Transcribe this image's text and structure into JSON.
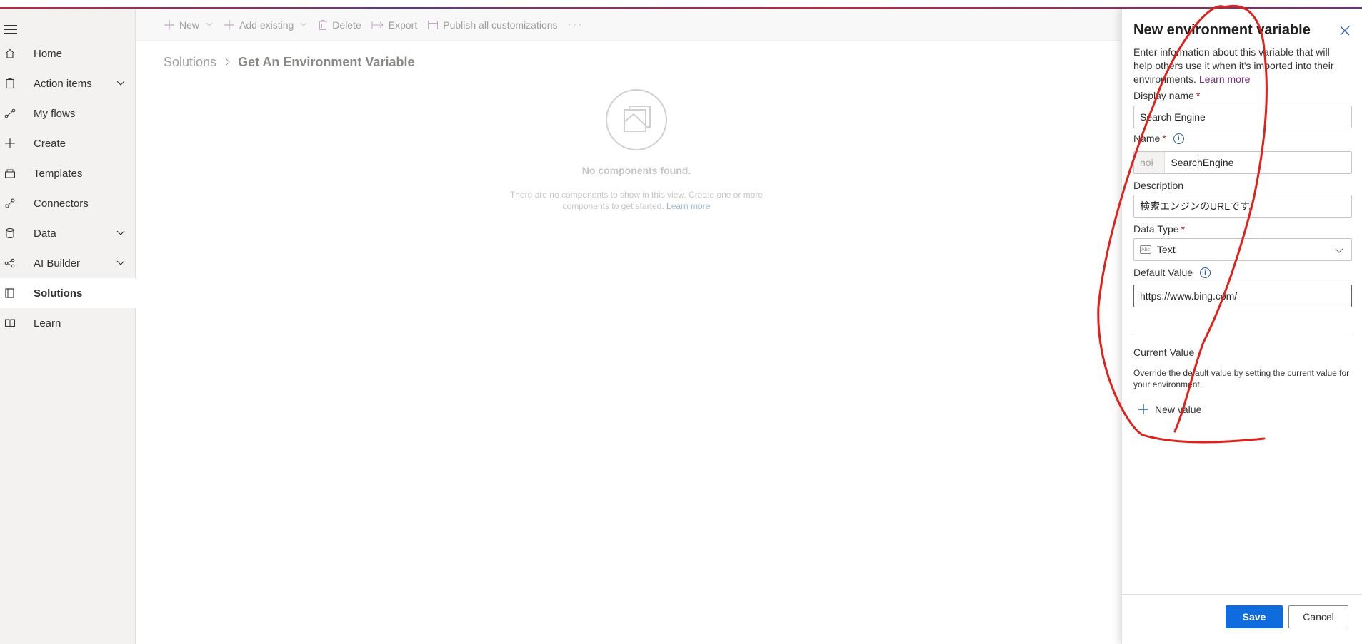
{
  "nav": {
    "items": [
      {
        "label": "Home",
        "icon": "home-icon"
      },
      {
        "label": "Action items",
        "icon": "clipboard-icon",
        "expandable": true
      },
      {
        "label": "My flows",
        "icon": "flow-icon"
      },
      {
        "label": "Create",
        "icon": "plus-icon"
      },
      {
        "label": "Templates",
        "icon": "templates-icon"
      },
      {
        "label": "Connectors",
        "icon": "connector-icon"
      },
      {
        "label": "Data",
        "icon": "database-icon",
        "expandable": true
      },
      {
        "label": "AI Builder",
        "icon": "ai-builder-icon",
        "expandable": true
      },
      {
        "label": "Solutions",
        "icon": "solutions-icon",
        "active": true
      },
      {
        "label": "Learn",
        "icon": "book-icon"
      }
    ]
  },
  "toolbar": {
    "new_label": "New",
    "add_existing_label": "Add existing",
    "delete_label": "Delete",
    "export_label": "Export",
    "publish_label": "Publish all customizations",
    "more_label": "···"
  },
  "breadcrumb": {
    "root": "Solutions",
    "current": "Get An Environment Variable"
  },
  "empty_state": {
    "title": "No components found.",
    "description": "There are no components to show in this view. Create one or more components to get started.",
    "link": "Learn more"
  },
  "panel": {
    "title": "New environment variable",
    "intro": "Enter information about this variable that will help others use it when it's imported into their environments.",
    "intro_link": "Learn more",
    "display_name_label": "Display name",
    "display_name_value": "Search Engine",
    "name_label": "Name",
    "name_prefix": "noi_",
    "name_value": "SearchEngine",
    "description_label": "Description",
    "description_value": "検索エンジンのURLです。",
    "data_type_label": "Data Type",
    "data_type_value": "Text",
    "default_value_label": "Default Value",
    "default_value_value": "https://www.bing.com/",
    "current_value_title": "Current Value",
    "current_value_desc": "Override the default value by setting the current value for your environment.",
    "new_value_label": "New value",
    "save_label": "Save",
    "cancel_label": "Cancel",
    "required_mark": "*",
    "info_mark": "i"
  },
  "colors": {
    "primary": "#0f6cdd",
    "annotation": "#e0201b",
    "link_purple": "#7a2e7e"
  }
}
